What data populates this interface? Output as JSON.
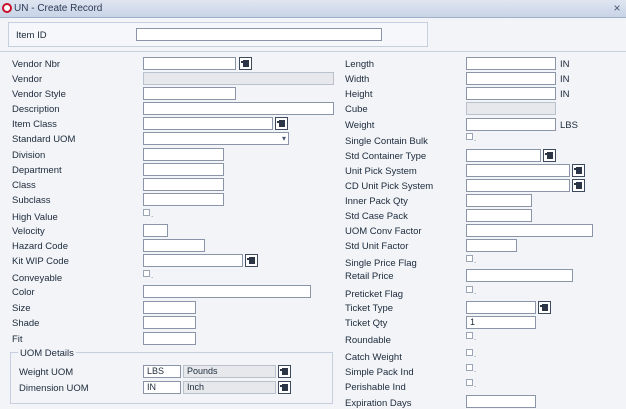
{
  "window": {
    "title": "UN - Create Record",
    "close_glyph": "×"
  },
  "item_id": {
    "label": "Item ID",
    "value": ""
  },
  "left": {
    "vendor_nbr": {
      "label": "Vendor Nbr",
      "value": ""
    },
    "vendor": {
      "label": "Vendor",
      "value": ""
    },
    "vendor_style": {
      "label": "Vendor Style",
      "value": ""
    },
    "description": {
      "label": "Description",
      "value": ""
    },
    "item_class": {
      "label": "Item Class",
      "value": ""
    },
    "standard_uom": {
      "label": "Standard UOM",
      "value": ""
    },
    "division": {
      "label": "Division",
      "value": ""
    },
    "department": {
      "label": "Department",
      "value": ""
    },
    "class": {
      "label": "Class",
      "value": ""
    },
    "subclass": {
      "label": "Subclass",
      "value": ""
    },
    "high_value": {
      "label": "High Value",
      "checked": false
    },
    "velocity": {
      "label": "Velocity",
      "value": ""
    },
    "hazard_code": {
      "label": "Hazard Code",
      "value": ""
    },
    "kit_wip_code": {
      "label": "Kit WIP Code",
      "value": ""
    },
    "conveyable": {
      "label": "Conveyable",
      "checked": false
    },
    "color": {
      "label": "Color",
      "value": ""
    },
    "size": {
      "label": "Size",
      "value": ""
    },
    "shade": {
      "label": "Shade",
      "value": ""
    },
    "fit": {
      "label": "Fit",
      "value": ""
    }
  },
  "uom_details": {
    "legend": "UOM Details",
    "weight_uom": {
      "label": "Weight UOM",
      "code": "LBS",
      "desc": "Pounds"
    },
    "dimension_uom": {
      "label": "Dimension UOM",
      "code": "IN",
      "desc": "Inch"
    }
  },
  "right": {
    "length": {
      "label": "Length",
      "value": "",
      "unit": "IN"
    },
    "width": {
      "label": "Width",
      "value": "",
      "unit": "IN"
    },
    "height": {
      "label": "Height",
      "value": "",
      "unit": "IN"
    },
    "cube": {
      "label": "Cube",
      "value": ""
    },
    "weight": {
      "label": "Weight",
      "value": "",
      "unit": "LBS"
    },
    "single_contain_bulk": {
      "label": "Single Contain Bulk",
      "checked": false
    },
    "std_container_type": {
      "label": "Std Container Type",
      "value": ""
    },
    "unit_pick_system": {
      "label": "Unit Pick System",
      "value": ""
    },
    "cd_unit_pick_system": {
      "label": "CD Unit Pick System",
      "value": ""
    },
    "inner_pack_qty": {
      "label": "Inner Pack Qty",
      "value": ""
    },
    "std_case_pack": {
      "label": "Std Case Pack",
      "value": ""
    },
    "uom_conv_factor": {
      "label": "UOM Conv Factor",
      "value": ""
    },
    "std_unit_factor": {
      "label": "Std Unit Factor",
      "value": ""
    },
    "single_price_flag": {
      "label": "Single Price Flag",
      "checked": false
    },
    "retail_price": {
      "label": "Retail Price",
      "value": ""
    },
    "preticket_flag": {
      "label": "Preticket Flag",
      "checked": false
    },
    "ticket_type": {
      "label": "Ticket Type",
      "value": ""
    },
    "ticket_qty": {
      "label": "Ticket Qty",
      "value": "1"
    },
    "roundable": {
      "label": "Roundable",
      "checked": false
    },
    "catch_weight": {
      "label": "Catch Weight",
      "checked": false
    },
    "simple_pack_ind": {
      "label": "Simple Pack Ind",
      "checked": false
    },
    "perishable_ind": {
      "label": "Perishable Ind",
      "checked": false
    },
    "expiration_days": {
      "label": "Expiration Days",
      "value": ""
    }
  }
}
